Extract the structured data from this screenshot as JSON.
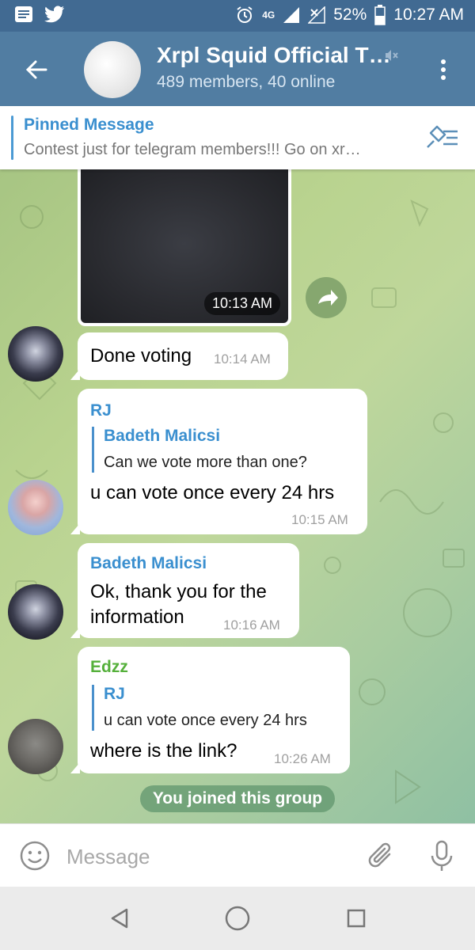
{
  "status_bar": {
    "network": "4G",
    "battery": "52%",
    "time": "10:27 AM"
  },
  "header": {
    "title": "Xrpl Squid Official T…",
    "subtitle": "489 members, 40 online"
  },
  "pinned": {
    "title": "Pinned Message",
    "text": "Contest just for telegram members!!! Go on xr…"
  },
  "messages": {
    "media": {
      "time": "10:13 AM"
    },
    "m1": {
      "text": "Done voting",
      "time": "10:14 AM"
    },
    "m2": {
      "sender": "RJ",
      "reply_name": "Badeth Malicsi",
      "reply_text": "Can we vote more than one?",
      "text": "u can vote once every 24 hrs",
      "time": "10:15 AM"
    },
    "m3": {
      "sender": "Badeth Malicsi",
      "text_line1": "Ok, thank you for the",
      "text_line2": "information",
      "time": "10:16 AM"
    },
    "m4": {
      "sender": "Edzz",
      "reply_name": "RJ",
      "reply_text": "u can vote once every 24 hrs",
      "text": "where is the link?",
      "time": "10:26 AM"
    },
    "service": "You joined this group"
  },
  "input": {
    "placeholder": "Message"
  },
  "colors": {
    "header": "#517da2",
    "status_bar": "#416a92",
    "accent_blue": "#3a8fcf",
    "sender_green": "#55b03b"
  },
  "icons": [
    "back-icon",
    "mute-icon",
    "more-vert-icon",
    "unpin-icon",
    "share-icon",
    "emoji-icon",
    "attach-icon",
    "mic-icon",
    "nav-back-icon",
    "nav-home-icon",
    "nav-recents-icon"
  ]
}
